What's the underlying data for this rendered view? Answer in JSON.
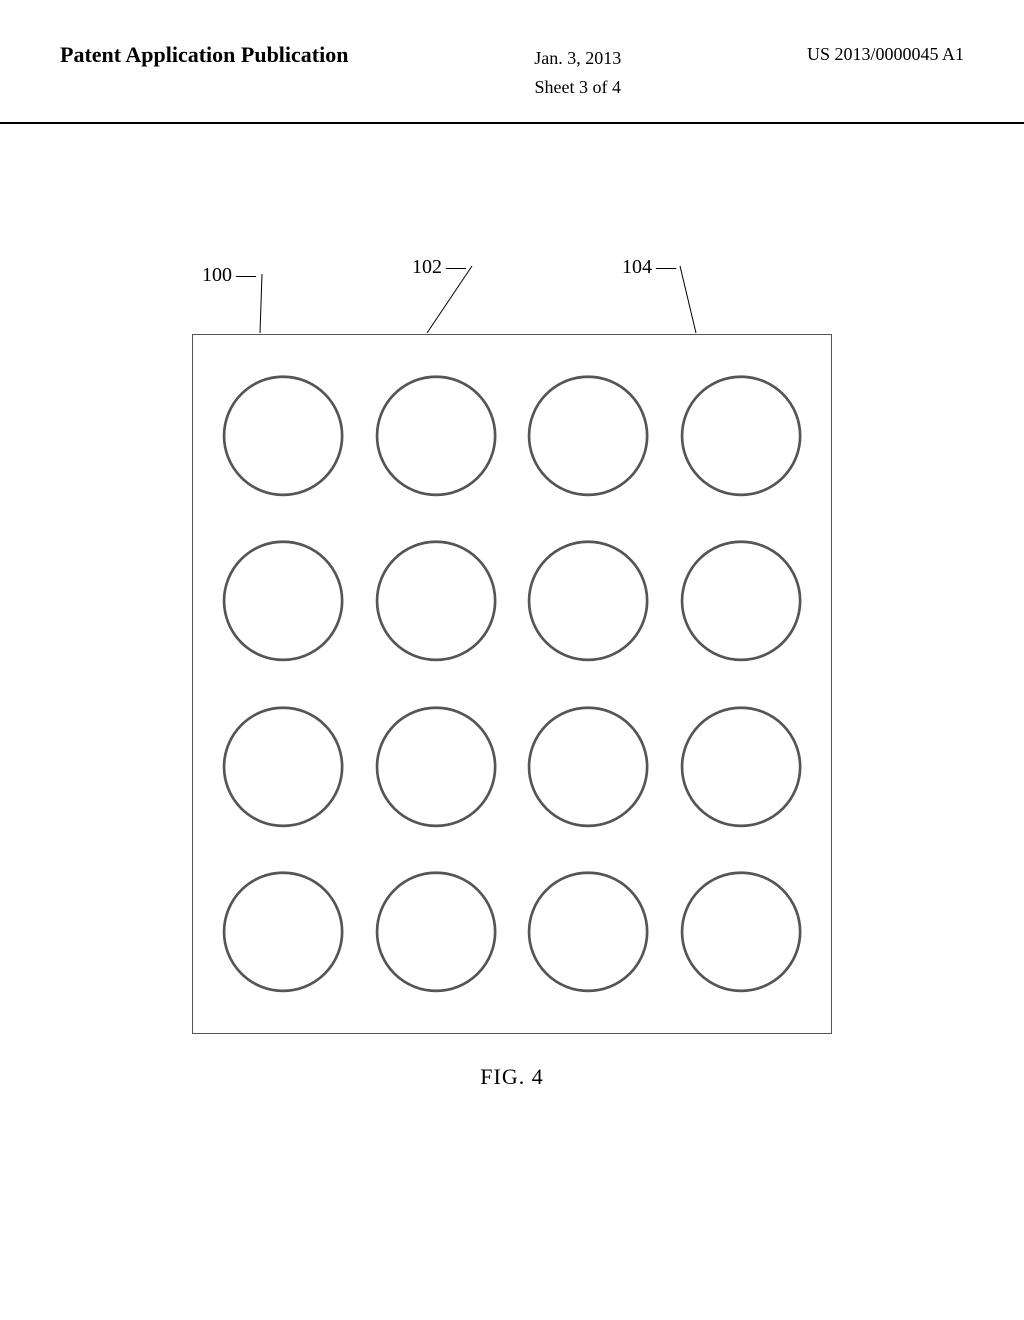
{
  "header": {
    "left_label": "Patent Application Publication",
    "date": "Jan. 3, 2013",
    "sheet": "Sheet 3 of 4",
    "patent_number": "US 2013/0000045 A1"
  },
  "diagram": {
    "callouts": [
      {
        "id": "100",
        "label": "100"
      },
      {
        "id": "102",
        "label": "102"
      },
      {
        "id": "104",
        "label": "104"
      }
    ],
    "grid_rows": 4,
    "grid_cols": 4,
    "fig_label": "FIG. 4"
  }
}
